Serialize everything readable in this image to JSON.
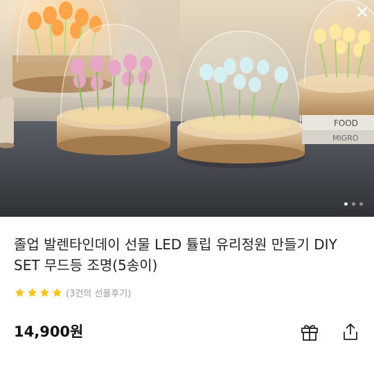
{
  "product": {
    "title": "졸업 발렌타인데이 선물 LED 튤립 유리정원 만들기 DIY SET 무드등 조명(5송이)",
    "rating_value": 4,
    "rating_max": 4,
    "review_text": "(3건의 선물후기)",
    "price": "14,900원"
  },
  "carousel": {
    "dot_count": 3,
    "active_index": 0
  },
  "hero_image": {
    "book_text_1": "FOOD",
    "book_text_2": "MIGRO"
  },
  "icons": {
    "close": "close-icon",
    "gift": "gift-icon",
    "share": "share-icon",
    "star": "star-icon"
  },
  "colors": {
    "star": "#f5c518",
    "text": "#222222",
    "muted": "#9a9a9a"
  }
}
